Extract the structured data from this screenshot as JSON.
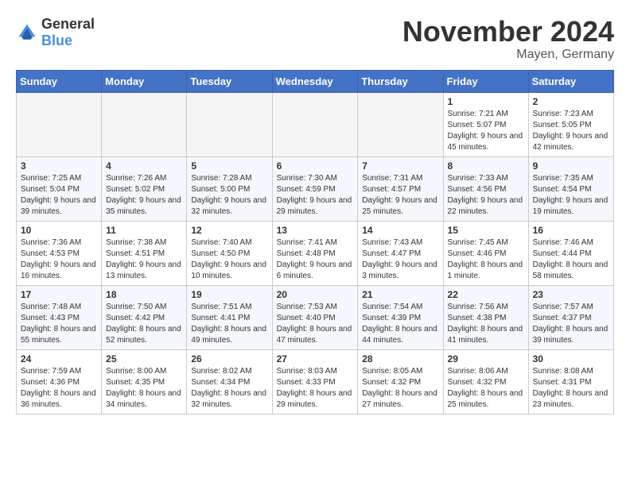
{
  "header": {
    "logo_general": "General",
    "logo_blue": "Blue",
    "month_title": "November 2024",
    "location": "Mayen, Germany"
  },
  "weekdays": [
    "Sunday",
    "Monday",
    "Tuesday",
    "Wednesday",
    "Thursday",
    "Friday",
    "Saturday"
  ],
  "weeks": [
    [
      {
        "day": "",
        "sunrise": "",
        "sunset": "",
        "daylight": ""
      },
      {
        "day": "",
        "sunrise": "",
        "sunset": "",
        "daylight": ""
      },
      {
        "day": "",
        "sunrise": "",
        "sunset": "",
        "daylight": ""
      },
      {
        "day": "",
        "sunrise": "",
        "sunset": "",
        "daylight": ""
      },
      {
        "day": "",
        "sunrise": "",
        "sunset": "",
        "daylight": ""
      },
      {
        "day": "1",
        "sunrise": "Sunrise: 7:21 AM",
        "sunset": "Sunset: 5:07 PM",
        "daylight": "Daylight: 9 hours and 45 minutes."
      },
      {
        "day": "2",
        "sunrise": "Sunrise: 7:23 AM",
        "sunset": "Sunset: 5:05 PM",
        "daylight": "Daylight: 9 hours and 42 minutes."
      }
    ],
    [
      {
        "day": "3",
        "sunrise": "Sunrise: 7:25 AM",
        "sunset": "Sunset: 5:04 PM",
        "daylight": "Daylight: 9 hours and 39 minutes."
      },
      {
        "day": "4",
        "sunrise": "Sunrise: 7:26 AM",
        "sunset": "Sunset: 5:02 PM",
        "daylight": "Daylight: 9 hours and 35 minutes."
      },
      {
        "day": "5",
        "sunrise": "Sunrise: 7:28 AM",
        "sunset": "Sunset: 5:00 PM",
        "daylight": "Daylight: 9 hours and 32 minutes."
      },
      {
        "day": "6",
        "sunrise": "Sunrise: 7:30 AM",
        "sunset": "Sunset: 4:59 PM",
        "daylight": "Daylight: 9 hours and 29 minutes."
      },
      {
        "day": "7",
        "sunrise": "Sunrise: 7:31 AM",
        "sunset": "Sunset: 4:57 PM",
        "daylight": "Daylight: 9 hours and 25 minutes."
      },
      {
        "day": "8",
        "sunrise": "Sunrise: 7:33 AM",
        "sunset": "Sunset: 4:56 PM",
        "daylight": "Daylight: 9 hours and 22 minutes."
      },
      {
        "day": "9",
        "sunrise": "Sunrise: 7:35 AM",
        "sunset": "Sunset: 4:54 PM",
        "daylight": "Daylight: 9 hours and 19 minutes."
      }
    ],
    [
      {
        "day": "10",
        "sunrise": "Sunrise: 7:36 AM",
        "sunset": "Sunset: 4:53 PM",
        "daylight": "Daylight: 9 hours and 16 minutes."
      },
      {
        "day": "11",
        "sunrise": "Sunrise: 7:38 AM",
        "sunset": "Sunset: 4:51 PM",
        "daylight": "Daylight: 9 hours and 13 minutes."
      },
      {
        "day": "12",
        "sunrise": "Sunrise: 7:40 AM",
        "sunset": "Sunset: 4:50 PM",
        "daylight": "Daylight: 9 hours and 10 minutes."
      },
      {
        "day": "13",
        "sunrise": "Sunrise: 7:41 AM",
        "sunset": "Sunset: 4:48 PM",
        "daylight": "Daylight: 9 hours and 6 minutes."
      },
      {
        "day": "14",
        "sunrise": "Sunrise: 7:43 AM",
        "sunset": "Sunset: 4:47 PM",
        "daylight": "Daylight: 9 hours and 3 minutes."
      },
      {
        "day": "15",
        "sunrise": "Sunrise: 7:45 AM",
        "sunset": "Sunset: 4:46 PM",
        "daylight": "Daylight: 8 hours and 1 minute."
      },
      {
        "day": "16",
        "sunrise": "Sunrise: 7:46 AM",
        "sunset": "Sunset: 4:44 PM",
        "daylight": "Daylight: 8 hours and 58 minutes."
      }
    ],
    [
      {
        "day": "17",
        "sunrise": "Sunrise: 7:48 AM",
        "sunset": "Sunset: 4:43 PM",
        "daylight": "Daylight: 8 hours and 55 minutes."
      },
      {
        "day": "18",
        "sunrise": "Sunrise: 7:50 AM",
        "sunset": "Sunset: 4:42 PM",
        "daylight": "Daylight: 8 hours and 52 minutes."
      },
      {
        "day": "19",
        "sunrise": "Sunrise: 7:51 AM",
        "sunset": "Sunset: 4:41 PM",
        "daylight": "Daylight: 8 hours and 49 minutes."
      },
      {
        "day": "20",
        "sunrise": "Sunrise: 7:53 AM",
        "sunset": "Sunset: 4:40 PM",
        "daylight": "Daylight: 8 hours and 47 minutes."
      },
      {
        "day": "21",
        "sunrise": "Sunrise: 7:54 AM",
        "sunset": "Sunset: 4:39 PM",
        "daylight": "Daylight: 8 hours and 44 minutes."
      },
      {
        "day": "22",
        "sunrise": "Sunrise: 7:56 AM",
        "sunset": "Sunset: 4:38 PM",
        "daylight": "Daylight: 8 hours and 41 minutes."
      },
      {
        "day": "23",
        "sunrise": "Sunrise: 7:57 AM",
        "sunset": "Sunset: 4:37 PM",
        "daylight": "Daylight: 8 hours and 39 minutes."
      }
    ],
    [
      {
        "day": "24",
        "sunrise": "Sunrise: 7:59 AM",
        "sunset": "Sunset: 4:36 PM",
        "daylight": "Daylight: 8 hours and 36 minutes."
      },
      {
        "day": "25",
        "sunrise": "Sunrise: 8:00 AM",
        "sunset": "Sunset: 4:35 PM",
        "daylight": "Daylight: 8 hours and 34 minutes."
      },
      {
        "day": "26",
        "sunrise": "Sunrise: 8:02 AM",
        "sunset": "Sunset: 4:34 PM",
        "daylight": "Daylight: 8 hours and 32 minutes."
      },
      {
        "day": "27",
        "sunrise": "Sunrise: 8:03 AM",
        "sunset": "Sunset: 4:33 PM",
        "daylight": "Daylight: 8 hours and 29 minutes."
      },
      {
        "day": "28",
        "sunrise": "Sunrise: 8:05 AM",
        "sunset": "Sunset: 4:32 PM",
        "daylight": "Daylight: 8 hours and 27 minutes."
      },
      {
        "day": "29",
        "sunrise": "Sunrise: 8:06 AM",
        "sunset": "Sunset: 4:32 PM",
        "daylight": "Daylight: 8 hours and 25 minutes."
      },
      {
        "day": "30",
        "sunrise": "Sunrise: 8:08 AM",
        "sunset": "Sunset: 4:31 PM",
        "daylight": "Daylight: 8 hours and 23 minutes."
      }
    ]
  ]
}
